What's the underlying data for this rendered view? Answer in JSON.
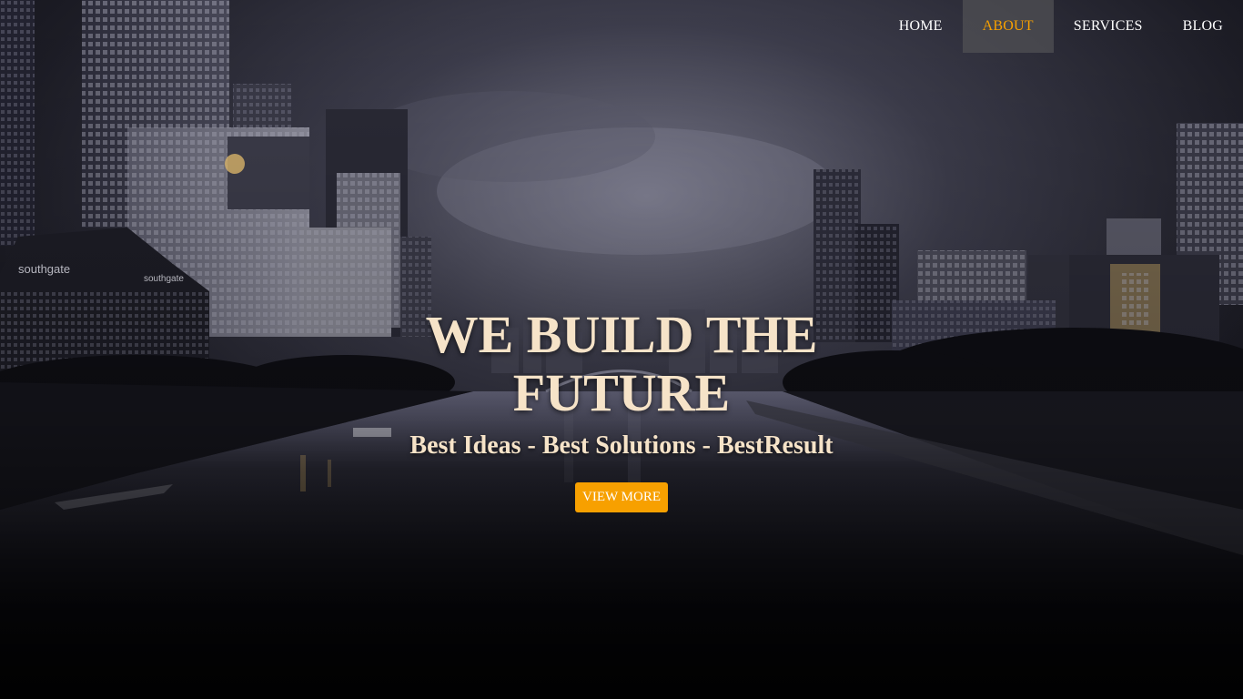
{
  "nav": {
    "items": [
      {
        "label": "HOME",
        "active": false
      },
      {
        "label": "ABOUT",
        "active": true
      },
      {
        "label": "SERVICES",
        "active": false
      },
      {
        "label": "BLOG",
        "active": false
      }
    ],
    "active_color": "#f7a000"
  },
  "hero": {
    "title": "WE BUILD THE FUTURE",
    "subtitle": "Best Ideas - Best Solutions - BestResult",
    "button_label": "VIEW MORE",
    "button_color": "#f7a000",
    "text_color": "#f6e3c8"
  },
  "background": {
    "image": "night-city-skyline-river",
    "signs": [
      "southgate",
      "southgate"
    ]
  }
}
